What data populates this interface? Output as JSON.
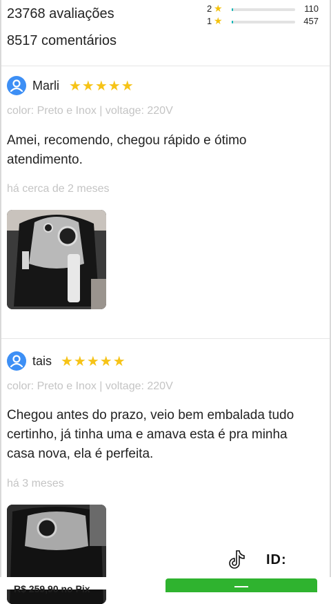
{
  "summary": {
    "ratings_count": "23768 avaliações",
    "comments_count": "8517 comentários",
    "breakdown": [
      {
        "stars": "2",
        "count": "110",
        "fraction": 0.01
      },
      {
        "stars": "1",
        "count": "457",
        "fraction": 0.02
      }
    ]
  },
  "reviews": [
    {
      "name": "Marli",
      "stars": "★★★★★",
      "variant": "color: Preto e Inox | voltage: 220V",
      "text": "Amei, recomendo, chegou rápido e ótimo atendimento.",
      "date": "há cerca de 2 meses"
    },
    {
      "name": "tais",
      "stars": "★★★★★",
      "variant": "color: Preto e Inox | voltage: 220V",
      "text": "Chegou antes do prazo, veio bem embalada tudo certinho, já tinha uma e amava esta é pra minha casa nova, ela é perfeita.",
      "date": "há 3 meses"
    }
  ],
  "footer": {
    "price": "R$ 259,90 no Pix",
    "buy_label": ""
  },
  "overlay": {
    "app_icon": "tiktok-icon",
    "user_id": "ID:"
  },
  "colors": {
    "star": "#f6c317",
    "avatar": "#3d8ff5",
    "bar_fill": "#00b3b3",
    "buy_button": "#2fb32f"
  }
}
